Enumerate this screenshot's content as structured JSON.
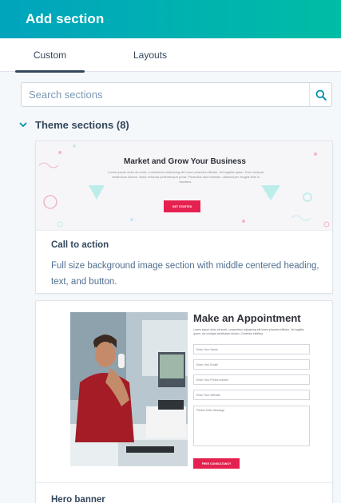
{
  "header": {
    "title": "Add section"
  },
  "tabs": [
    {
      "label": "Custom"
    },
    {
      "label": "Layouts"
    }
  ],
  "search": {
    "placeholder": "Search sections"
  },
  "group": {
    "label": "Theme sections (8)"
  },
  "cards": [
    {
      "thumbnail": {
        "title": "Market and Grow Your Business",
        "body": "Lorem ipsum dolor sit amet, consectetur adipiscing elit lorem pharetra efficitur. Vel sagittis quam. Duis volutpat vestibulum dictum. Nulla vehicula pellentesque porta. Phasellus sed molestie, ullamcorper feugiat felis in faucibus.",
        "button": "GET STARTED"
      },
      "title": "Call to action",
      "description": "Full size background image section with middle centered heading, text, and button."
    },
    {
      "thumbnail": {
        "title": "Make an Appointment",
        "body": "Lorem ipsum dolor sit amet, consectetur adipiscing elit lorem pharetra efficitur. Vel sagittis quam, dui volutpat vestibulum dictum. Curabitur eleifend.",
        "fields": [
          "Enter Your Name",
          "Enter Your Email*",
          "Enter Your Phone number",
          "Enter Your Website",
          "Please Enter Message"
        ],
        "button": "FREE CONSULTANCY"
      },
      "title": "Hero banner"
    }
  ],
  "colors": {
    "header_start": "#00a4bd",
    "header_end": "#00bda5",
    "accent_pink": "#e5214f",
    "text": "#33475b",
    "icon": "#0091ae"
  },
  "icons": {
    "search": "search-icon",
    "chevron": "chevron-down-icon"
  }
}
